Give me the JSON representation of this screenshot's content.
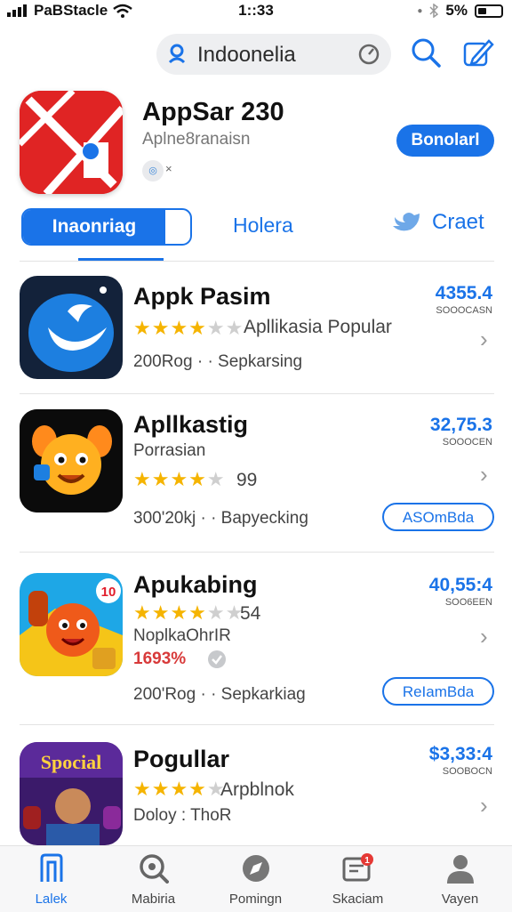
{
  "status_bar": {
    "carrier": "PaBStacle",
    "time": "1::33",
    "battery": "5%"
  },
  "search": {
    "value": "Indoonelia"
  },
  "hero": {
    "title": "AppSar 230",
    "subtitle": "Aplne8ranaisn",
    "badge_suffix": "×",
    "download_label": "Bonolarl"
  },
  "tabs": {
    "active": "Inaonriag",
    "second": "Holera",
    "third": "Craet"
  },
  "apps": [
    {
      "title": "Appk Pasim",
      "stars_full": "★★★★",
      "stars_empty": "★★",
      "rating_text": "Apllikasia Popular",
      "meta": "200Rog · · Sepkarsing",
      "price": "4355.4",
      "price_sub": "SOOOCASN"
    },
    {
      "title": "Apllkastig",
      "subtitle": "Porrasian",
      "stars_full": "★★★★",
      "stars_empty": "★",
      "rating_text": "99",
      "meta": "300'20kj · · Bapyecking",
      "price": "32,75.3",
      "price_sub": "SOOOCEN",
      "button": "ASOmBda"
    },
    {
      "title": "Apukabing",
      "stars_full": "★★★★",
      "stars_empty": "★★",
      "rating_text": "54",
      "subtitle": "NoplkaOhrIR",
      "discount": "1693%",
      "meta": "200'Rog · · Sepkarkiag",
      "price": "40,55:4",
      "price_sub": "SOO6EEN",
      "button": "ReIamBda",
      "badge": "10"
    },
    {
      "title": "Pogullar",
      "stars_full": "★★★★",
      "stars_empty": "★",
      "rating_text": "Arpblnok",
      "subtitle": "Doloy : ThoR",
      "price": "$3,33:4",
      "price_sub": "SOOBOCN",
      "icon_text": "Spocial"
    }
  ],
  "bottom_nav": [
    {
      "label": "Lalek",
      "icon": "bookmark-icon"
    },
    {
      "label": "Mabiria",
      "icon": "search-icon"
    },
    {
      "label": "Pomingn",
      "icon": "compass-icon"
    },
    {
      "label": "Skaciam",
      "icon": "message-icon",
      "badge": "1"
    },
    {
      "label": "Vayen",
      "icon": "person-icon"
    }
  ],
  "colors": {
    "accent": "#1a73e8",
    "star": "#f5b400",
    "discount": "#d83a3a"
  }
}
